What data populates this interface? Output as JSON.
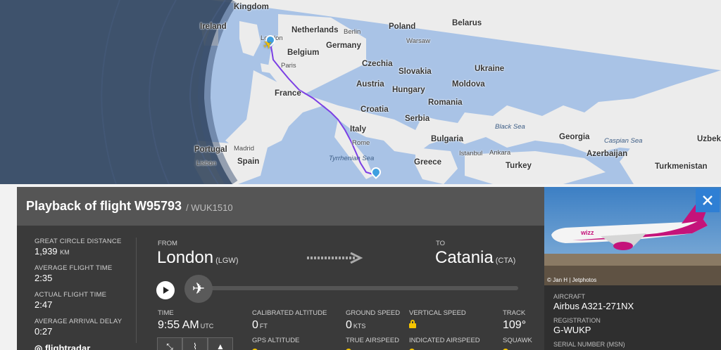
{
  "map": {
    "countries": [
      "Kingdom",
      "Ireland",
      "Netherlands",
      "Poland",
      "Belarus",
      "Belgium",
      "Germany",
      "Czechia",
      "Ukraine",
      "Slovakia",
      "France",
      "Austria",
      "Moldova",
      "Hungary",
      "Romania",
      "Croatia",
      "Serbia",
      "Italy",
      "Bulgaria",
      "Portugal",
      "Spain",
      "Georgia",
      "Azerbaijan",
      "Greece",
      "Turkey",
      "Turkmenistan",
      "Uzbeki"
    ],
    "cities": [
      "London",
      "Berlin",
      "Warsaw",
      "Paris",
      "Madrid",
      "Lisbon",
      "Rome",
      "Istanbul",
      "Ankara"
    ],
    "seas": [
      "Black Sea",
      "Caspian Sea",
      "Tyrrhenian Sea"
    ],
    "colors": {
      "sea": "#a9c3e6",
      "land": "#ececec",
      "route": "#7b3fe4",
      "night": "#2c3e56"
    }
  },
  "panel": {
    "title": "Playback of flight W95793",
    "callsign": "/ WUK1510",
    "stats": [
      {
        "label": "GREAT CIRCLE DISTANCE",
        "value": "1,939",
        "unit": "KM"
      },
      {
        "label": "AVERAGE FLIGHT TIME",
        "value": "2:35",
        "unit": ""
      },
      {
        "label": "ACTUAL FLIGHT TIME",
        "value": "2:47",
        "unit": ""
      },
      {
        "label": "AVERAGE ARRIVAL DELAY",
        "value": "0:27",
        "unit": ""
      }
    ],
    "logo_text": "flightradar",
    "from": {
      "label": "FROM",
      "city": "London",
      "iata": "(LGW)"
    },
    "to": {
      "label": "TO",
      "city": "Catania",
      "iata": "(CTA)"
    },
    "data": {
      "time": {
        "label": "TIME",
        "value": "9:55 AM",
        "unit": "UTC"
      },
      "cal_alt": {
        "label": "CALIBRATED ALTITUDE",
        "value": "0",
        "unit": "FT",
        "label2": "GPS ALTITUDE"
      },
      "ground_speed": {
        "label": "GROUND SPEED",
        "value": "0",
        "unit": "KTS",
        "label2": "TRUE AIRSPEED"
      },
      "vertical_speed": {
        "label": "VERTICAL SPEED",
        "label2": "INDICATED AIRSPEED"
      },
      "track": {
        "label": "TRACK",
        "value": "109°",
        "label2": "SQUAWK"
      }
    }
  },
  "aircraft": {
    "credit": "© Jan H | Jetphotos",
    "aircraft_label": "AIRCRAFT",
    "aircraft_value": "Airbus A321-271NX",
    "reg_label": "REGISTRATION",
    "reg_value": "G-WUKP",
    "msn_label": "SERIAL NUMBER (MSN)"
  }
}
